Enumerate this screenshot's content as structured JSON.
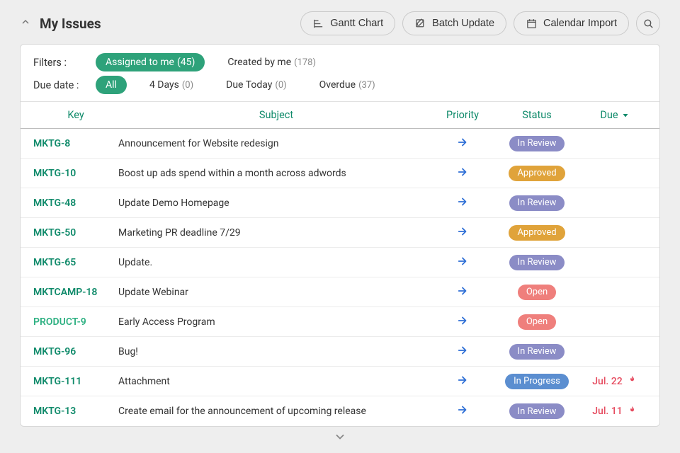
{
  "header": {
    "title": "My Issues",
    "buttons": {
      "gantt": "Gantt Chart",
      "batch": "Batch Update",
      "calendar": "Calendar Import"
    }
  },
  "filters": {
    "filters_label": "Filters :",
    "assigned_label": "Assigned to me",
    "assigned_count": "(45)",
    "created_label": "Created by me",
    "created_count": "(178)",
    "duedate_label": "Due date :",
    "all_label": "All",
    "fourdays_label": "4 Days",
    "fourdays_count": "(0)",
    "duetoday_label": "Due Today",
    "duetoday_count": "(0)",
    "overdue_label": "Overdue",
    "overdue_count": "(37)"
  },
  "columns": {
    "key": "Key",
    "subject": "Subject",
    "priority": "Priority",
    "status": "Status",
    "due": "Due"
  },
  "status_labels": {
    "review": "In Review",
    "approved": "Approved",
    "open": "Open",
    "progress": "In Progress"
  },
  "rows": [
    {
      "key": "MKTG-8",
      "subject": "Announcement for Website redesign",
      "status": "review",
      "due": ""
    },
    {
      "key": "MKTG-10",
      "subject": "Boost up ads spend within a month across adwords",
      "status": "approved",
      "due": ""
    },
    {
      "key": "MKTG-48",
      "subject": "Update Demo Homepage",
      "status": "review",
      "due": ""
    },
    {
      "key": "MKTG-50",
      "subject": "Marketing PR deadline 7/29",
      "status": "approved",
      "due": ""
    },
    {
      "key": "MKTG-65",
      "subject": "Update.",
      "status": "review",
      "due": ""
    },
    {
      "key": "MKTCAMP-18",
      "subject": "Update Webinar",
      "status": "open",
      "due": ""
    },
    {
      "key": "PRODUCT-9",
      "subject": "Early Access Program",
      "status": "open",
      "due": "",
      "alt": true
    },
    {
      "key": "MKTG-96",
      "subject": "Bug!",
      "status": "review",
      "due": ""
    },
    {
      "key": "MKTG-111",
      "subject": "Attachment",
      "status": "progress",
      "due": "Jul. 22",
      "fire": true
    },
    {
      "key": "MKTG-13",
      "subject": "Create email for the announcement of upcoming release",
      "status": "review",
      "due": "Jul. 11",
      "fire": true
    }
  ]
}
